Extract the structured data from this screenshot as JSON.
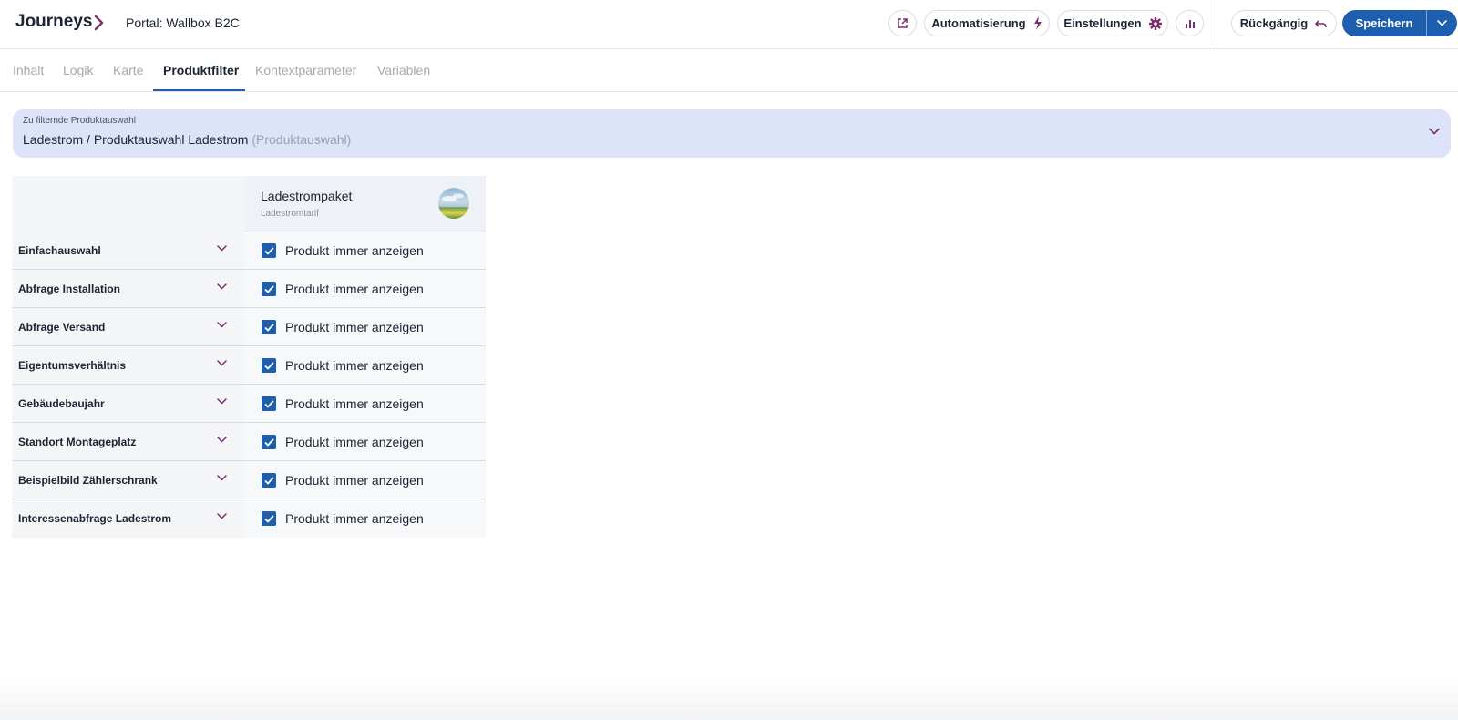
{
  "header": {
    "brand": "Journeys",
    "portal_title": "Portal: Wallbox B2C",
    "automation_label": "Automatisierung",
    "settings_label": "Einstellungen",
    "undo_label": "Rückgängig",
    "save_label": "Speichern",
    "icons": {
      "breadcrumb": "chevron-right-icon",
      "open_external": "external-link-icon",
      "automation": "lightning-icon",
      "settings": "gear-icon",
      "analytics": "bar-chart-icon",
      "undo": "undo-icon",
      "save_menu": "chevron-down-icon"
    }
  },
  "tabs": [
    {
      "label": "Inhalt",
      "active": false
    },
    {
      "label": "Logik",
      "active": false
    },
    {
      "label": "Karte",
      "active": false
    },
    {
      "label": "Produktfilter",
      "active": true
    },
    {
      "label": "Kontextparameter",
      "active": false
    },
    {
      "label": "Variablen",
      "active": false
    }
  ],
  "selection": {
    "label": "Zu filternde Produktauswahl",
    "value": "Ladestrom / Produktauswahl Ladestrom",
    "type": "(Produktauswahl)"
  },
  "product": {
    "name": "Ladestrompaket",
    "subtitle": "Ladestromtarif"
  },
  "rows": [
    {
      "label": "Einfachauswahl",
      "option": "Produkt immer anzeigen",
      "checked": true
    },
    {
      "label": "Abfrage Installation",
      "option": "Produkt immer anzeigen",
      "checked": true
    },
    {
      "label": "Abfrage Versand",
      "option": "Produkt immer anzeigen",
      "checked": true
    },
    {
      "label": "Eigentumsverhältnis",
      "option": "Produkt immer anzeigen",
      "checked": true
    },
    {
      "label": "Gebäudebaujahr",
      "option": "Produkt immer anzeigen",
      "checked": true
    },
    {
      "label": "Standort Montageplatz",
      "option": "Produkt immer anzeigen",
      "checked": true
    },
    {
      "label": "Beispielbild Zählerschrank",
      "option": "Produkt immer anzeigen",
      "checked": true
    },
    {
      "label": "Interessenabfrage Ladestrom",
      "option": "Produkt immer anzeigen",
      "checked": true
    }
  ],
  "colors": {
    "accent": "#1d5fae",
    "icon_purple": "#7b2d6e",
    "select_bg": "#dde3f8"
  }
}
